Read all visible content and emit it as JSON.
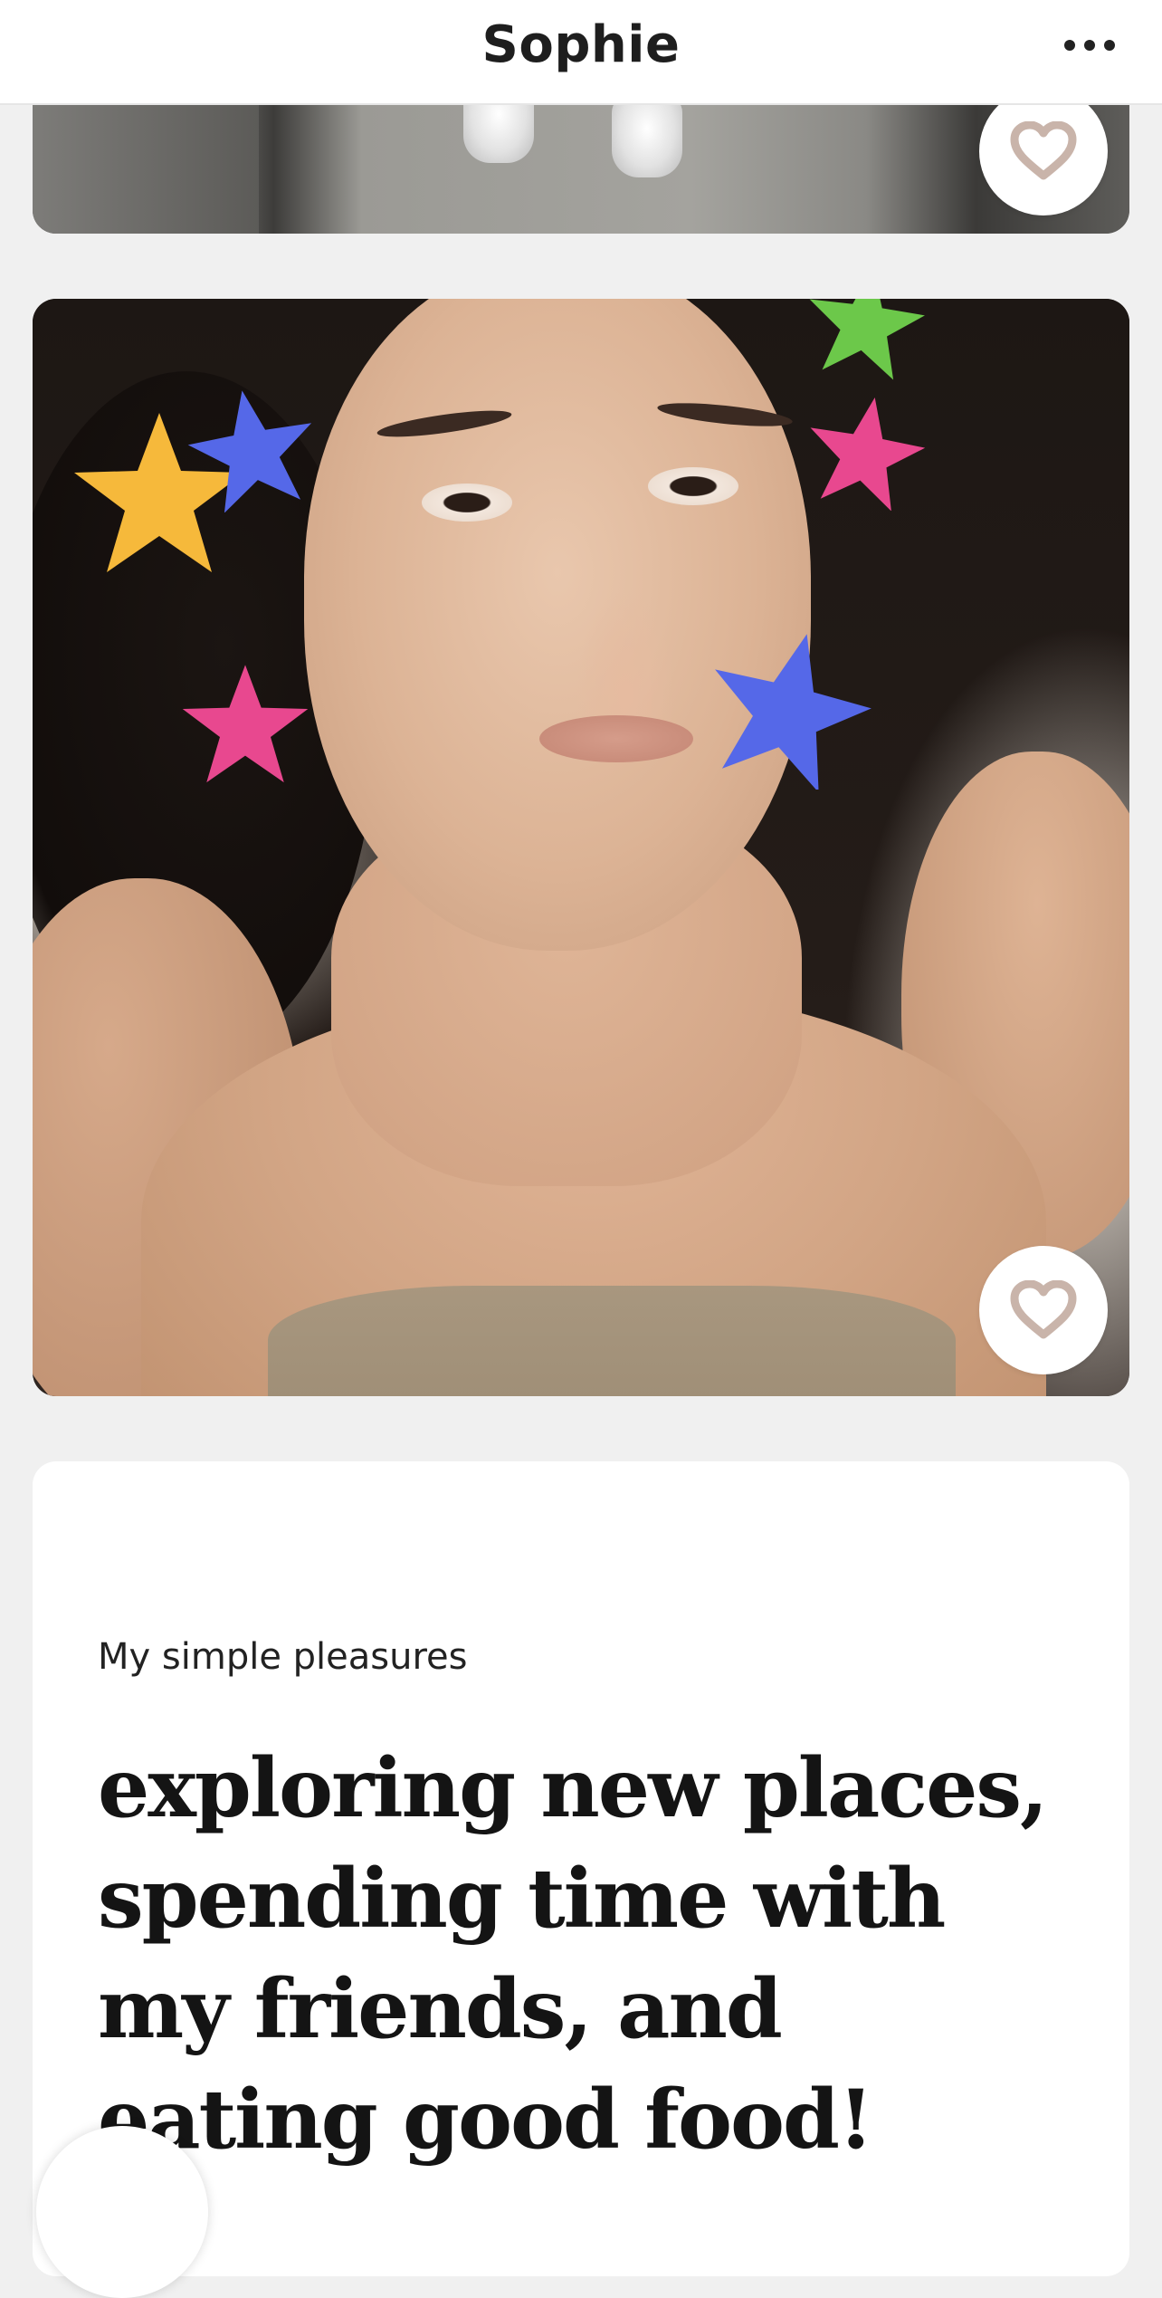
{
  "header": {
    "title": "Sophie",
    "more_icon": "more-horizontal-icon"
  },
  "photos": [
    {
      "like_icon": "heart-outline-icon"
    },
    {
      "like_icon": "heart-outline-icon"
    }
  ],
  "prompt": {
    "label": "My simple pleasures",
    "answer": "exploring new places, spending time with my friends, and eating good food!"
  },
  "colors": {
    "background": "#f0f0f0",
    "card": "#ffffff",
    "heart_stroke": "#c9b4aa",
    "star_yellow": "#f6b93b",
    "star_blue": "#5568e8",
    "star_pink": "#e8488f",
    "star_green": "#6cc84a"
  }
}
